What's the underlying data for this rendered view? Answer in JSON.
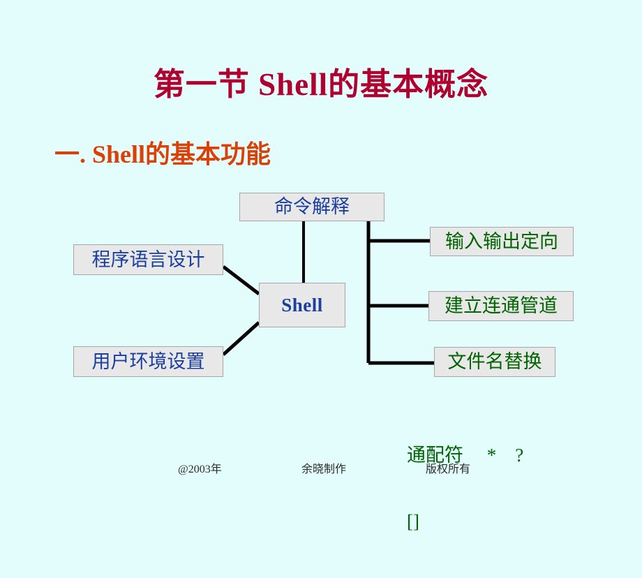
{
  "slide": {
    "background_color": "#e2fdfb",
    "title": "第一节 Shell的基本概念",
    "title_color": "#b00030",
    "subtitle": "一. Shell的基本功能",
    "subtitle_color": "#da4109"
  },
  "diagram": {
    "type": "node-link",
    "center_node": {
      "label": "Shell",
      "text_color": "#1b3f9e"
    },
    "top_node": {
      "label": "命令解释",
      "text_color": "#1b3f9e"
    },
    "left_nodes": [
      {
        "label": "程序语言设计",
        "text_color": "#1b3f9e"
      },
      {
        "label": "用户环境设置",
        "text_color": "#1b3f9e"
      }
    ],
    "right_nodes": [
      {
        "label": "输入输出定向",
        "text_color": "#006400"
      },
      {
        "label": "建立连通管道",
        "text_color": "#006400"
      },
      {
        "label": "文件名替换",
        "text_color": "#006400"
      }
    ],
    "node_fill": "#e8e8e8",
    "node_border": "#a6a6a6",
    "connector_color": "#000000"
  },
  "wildcard_note": {
    "line1": "通配符     *    ?",
    "line2": "[]",
    "color": "#006400"
  },
  "footer": {
    "left": "@2003年",
    "center": "余晓制作",
    "right": "版权所有"
  }
}
